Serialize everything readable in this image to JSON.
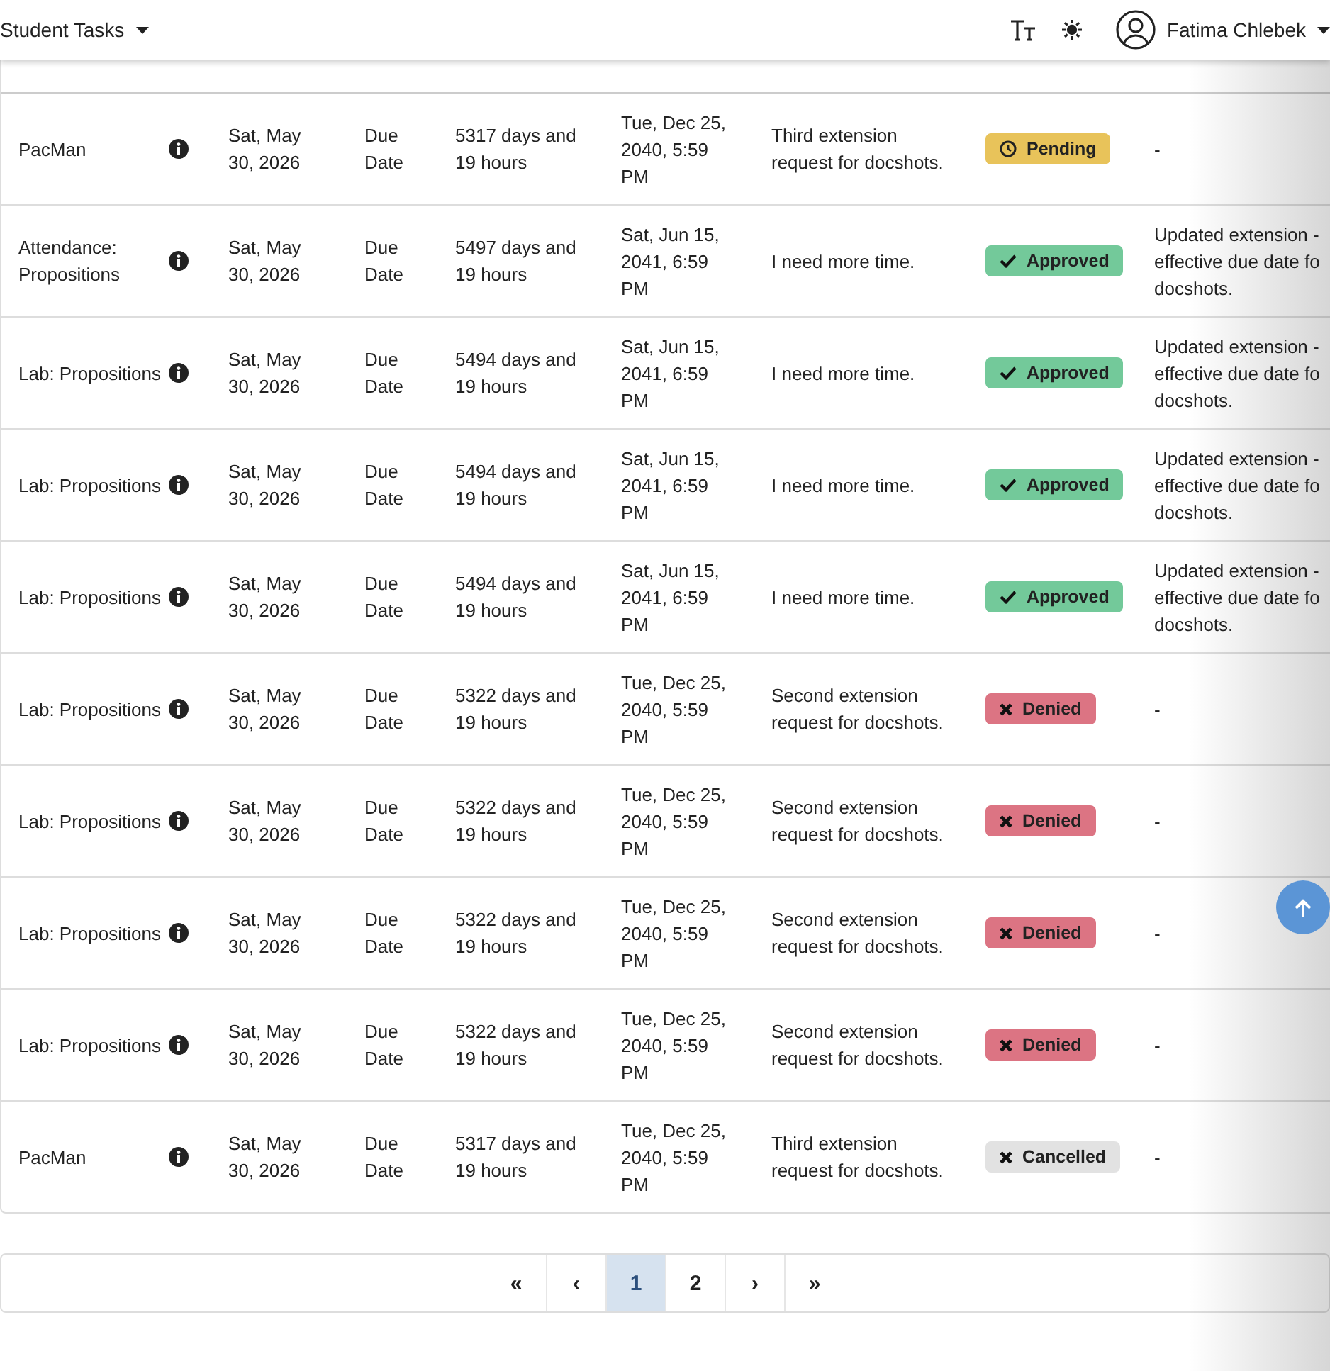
{
  "nav": {
    "title": "Student Tasks",
    "user": "Fatima Chlebek"
  },
  "table": {
    "rows": [
      {
        "assignment": "PacMan",
        "requested": "Sat, May 30, 2026",
        "type": "Due Date",
        "time": "5317 days and 19 hours",
        "due": "Tue, Dec 25, 2040, 5:59 PM",
        "reason": "Third extension request for docshots.",
        "status": {
          "kind": "pending",
          "label": "Pending"
        },
        "comment": "-"
      },
      {
        "assignment": "Attendance: Propositions",
        "requested": "Sat, May 30, 2026",
        "type": "Due Date",
        "time": "5497 days and 19 hours",
        "due": "Sat, Jun 15, 2041, 6:59 PM",
        "reason": "I need more time.",
        "status": {
          "kind": "approved",
          "label": "Approved"
        },
        "comment": "Updated extension -\neffective due date fo\ndocshots."
      },
      {
        "assignment": "Lab: Propositions",
        "requested": "Sat, May 30, 2026",
        "type": "Due Date",
        "time": "5494 days and 19 hours",
        "due": "Sat, Jun 15, 2041, 6:59 PM",
        "reason": "I need more time.",
        "status": {
          "kind": "approved",
          "label": "Approved"
        },
        "comment": "Updated extension -\neffective due date fo\ndocshots."
      },
      {
        "assignment": "Lab: Propositions",
        "requested": "Sat, May 30, 2026",
        "type": "Due Date",
        "time": "5494 days and 19 hours",
        "due": "Sat, Jun 15, 2041, 6:59 PM",
        "reason": "I need more time.",
        "status": {
          "kind": "approved",
          "label": "Approved"
        },
        "comment": "Updated extension -\neffective due date fo\ndocshots."
      },
      {
        "assignment": "Lab: Propositions",
        "requested": "Sat, May 30, 2026",
        "type": "Due Date",
        "time": "5494 days and 19 hours",
        "due": "Sat, Jun 15, 2041, 6:59 PM",
        "reason": "I need more time.",
        "status": {
          "kind": "approved",
          "label": "Approved"
        },
        "comment": "Updated extension -\neffective due date fo\ndocshots."
      },
      {
        "assignment": "Lab: Propositions",
        "requested": "Sat, May 30, 2026",
        "type": "Due Date",
        "time": "5322 days and 19 hours",
        "due": "Tue, Dec 25, 2040, 5:59 PM",
        "reason": "Second extension request for docshots.",
        "status": {
          "kind": "denied",
          "label": "Denied"
        },
        "comment": "-"
      },
      {
        "assignment": "Lab: Propositions",
        "requested": "Sat, May 30, 2026",
        "type": "Due Date",
        "time": "5322 days and 19 hours",
        "due": "Tue, Dec 25, 2040, 5:59 PM",
        "reason": "Second extension request for docshots.",
        "status": {
          "kind": "denied",
          "label": "Denied"
        },
        "comment": "-"
      },
      {
        "assignment": "Lab: Propositions",
        "requested": "Sat, May 30, 2026",
        "type": "Due Date",
        "time": "5322 days and 19 hours",
        "due": "Tue, Dec 25, 2040, 5:59 PM",
        "reason": "Second extension request for docshots.",
        "status": {
          "kind": "denied",
          "label": "Denied"
        },
        "comment": "-"
      },
      {
        "assignment": "Lab: Propositions",
        "requested": "Sat, May 30, 2026",
        "type": "Due Date",
        "time": "5322 days and 19 hours",
        "due": "Tue, Dec 25, 2040, 5:59 PM",
        "reason": "Second extension request for docshots.",
        "status": {
          "kind": "denied",
          "label": "Denied"
        },
        "comment": "-"
      },
      {
        "assignment": "PacMan",
        "requested": "Sat, May 30, 2026",
        "type": "Due Date",
        "time": "5317 days and 19 hours",
        "due": "Tue, Dec 25, 2040, 5:59 PM",
        "reason": "Third extension request for docshots.",
        "status": {
          "kind": "cancelled",
          "label": "Cancelled"
        },
        "comment": "-"
      }
    ]
  },
  "pagination": [
    {
      "label": "«",
      "selected": false
    },
    {
      "label": "‹",
      "selected": false
    },
    {
      "label": "1",
      "selected": true
    },
    {
      "label": "2",
      "selected": false
    },
    {
      "label": "›",
      "selected": false
    },
    {
      "label": "»",
      "selected": false
    }
  ]
}
